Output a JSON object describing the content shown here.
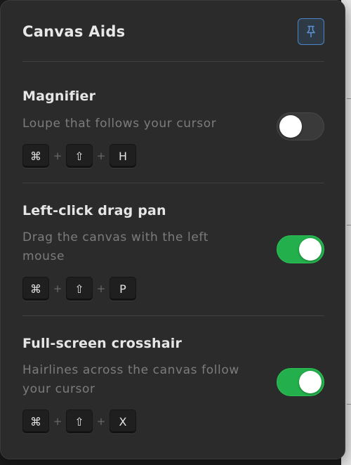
{
  "panel": {
    "title": "Canvas Aids",
    "pin_icon": "pin-icon",
    "pin_active": true
  },
  "sections": [
    {
      "title": "Magnifier",
      "description": "Loupe that follows your cursor",
      "enabled": false,
      "shortcut": [
        "⌘",
        "⇧",
        "H"
      ],
      "separator": "+"
    },
    {
      "title": "Left-click drag pan",
      "description": "Drag the canvas with the left mouse",
      "enabled": true,
      "shortcut": [
        "⌘",
        "⇧",
        "P"
      ],
      "separator": "+"
    },
    {
      "title": "Full-screen crosshair",
      "description": "Hairlines across the canvas follow your cursor",
      "enabled": true,
      "shortcut": [
        "⌘",
        "⇧",
        "X"
      ],
      "separator": "+"
    }
  ],
  "colors": {
    "panel_bg": "#2b2b2b",
    "toggle_on": "#23b04c",
    "toggle_off": "#3a3a3a",
    "pin_accent": "#4d84c8"
  }
}
